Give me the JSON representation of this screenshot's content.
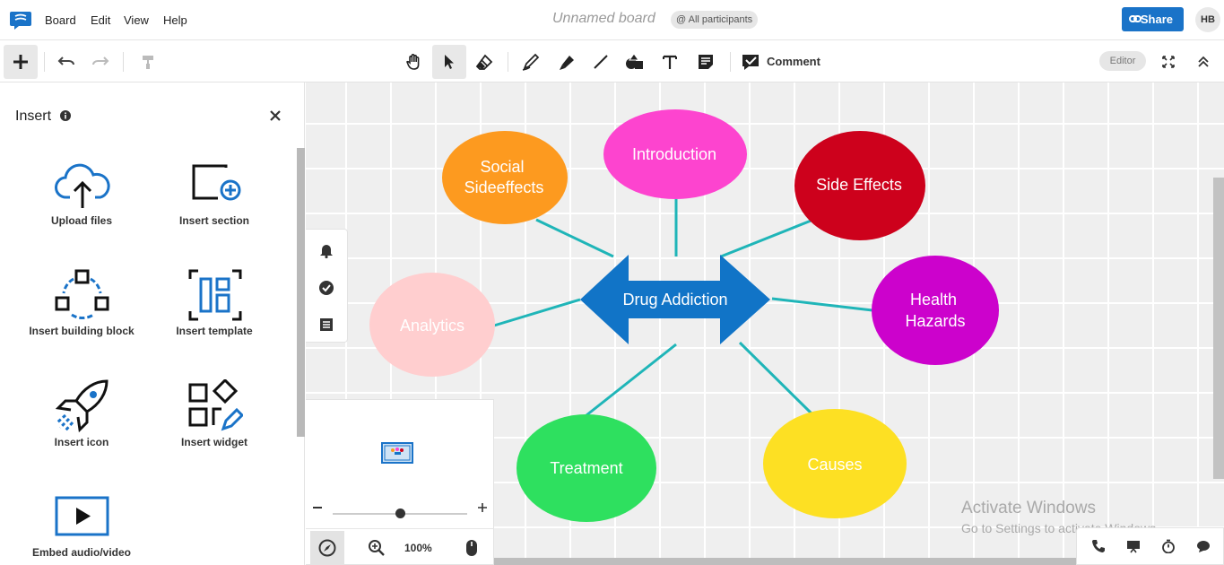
{
  "menubar": {
    "items": [
      "Board",
      "Edit",
      "View",
      "Help"
    ],
    "board_title": "Unnamed board",
    "participants": "@ All participants",
    "share_label": "Share",
    "avatar_initials": "HB"
  },
  "toolbar": {
    "comment_label": "Comment",
    "mode_badge": "Editor"
  },
  "insert_panel": {
    "title": "Insert",
    "items": [
      {
        "label": "Upload files",
        "icon": "upload-cloud-icon"
      },
      {
        "label": "Insert section",
        "icon": "insert-section-icon"
      },
      {
        "label": "Insert building block",
        "icon": "building-block-icon"
      },
      {
        "label": "Insert template",
        "icon": "template-icon"
      },
      {
        "label": "Insert icon",
        "icon": "rocket-icon"
      },
      {
        "label": "Insert widget",
        "icon": "widget-icon"
      },
      {
        "label": "Embed audio/video",
        "icon": "play-video-icon"
      }
    ]
  },
  "mindmap": {
    "center": "Drug Addiction",
    "nodes": [
      {
        "line1": "Social",
        "line2": "Sideeffects",
        "color": "#fd9a1f"
      },
      {
        "line1": "Introduction",
        "line2": "",
        "color": "#fd44cf"
      },
      {
        "line1": "Side Effects",
        "line2": "",
        "color": "#cd011c"
      },
      {
        "line1": "Health",
        "line2": "Hazards",
        "color": "#cc02cc"
      },
      {
        "line1": "Analytics",
        "line2": "",
        "color": "#ffcecf"
      },
      {
        "line1": "Treatment",
        "line2": "",
        "color": "#2ee05f"
      },
      {
        "line1": "Causes",
        "line2": "",
        "color": "#fde023"
      }
    ],
    "center_color": "#1174c7",
    "connector_color": "#1fb5b8"
  },
  "minimap": {
    "zoom": "100%"
  },
  "watermark": {
    "line1": "Activate Windows",
    "line2": "Go to Settings to activate Windows."
  }
}
